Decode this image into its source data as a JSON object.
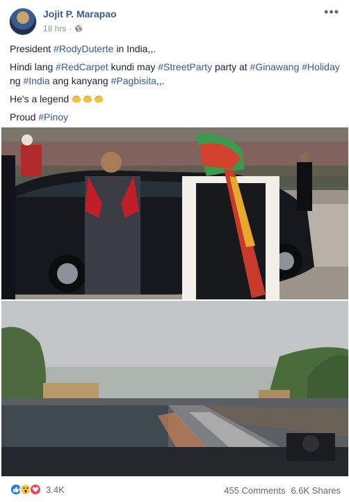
{
  "post": {
    "author": "Jojit P. Marapao",
    "time": "18 hrs",
    "privacy_icon": "globe-icon",
    "more_icon": "more-options-icon"
  },
  "text": {
    "line1_prefix": "President ",
    "line1_tag": "#RodyDuterte",
    "line1_suffix": " in India,,.",
    "line2_a": "Hindi lang ",
    "line2_tag1": "#RedCarpet",
    "line2_b": " kundi may ",
    "line2_tag2": "#StreetParty",
    "line2_c": " party at ",
    "line2_tag3": "#Ginawang",
    "line2_d": " ",
    "line2_tag4": "#Holiday",
    "line2_e": " ng ",
    "line2_tag5": "#India",
    "line2_f": " ang kanyang ",
    "line2_tag6": "#Pagbisita",
    "line2_g": ",,.",
    "line3": "He's a legend",
    "line3_emoji": "clapping-hands-emoji",
    "line4_prefix": "Proud ",
    "line4_tag": "#Pinoy"
  },
  "reactions": {
    "types": [
      "like",
      "wow",
      "love"
    ],
    "count": "3.4K"
  },
  "stats": {
    "comments": "455 Comments",
    "shares": "6.6K Shares"
  },
  "colors": {
    "link": "#385898",
    "text": "#1d2129",
    "meta": "#90949c",
    "like": "#2078f4",
    "wow": "#f7c843",
    "love": "#f33e58"
  }
}
